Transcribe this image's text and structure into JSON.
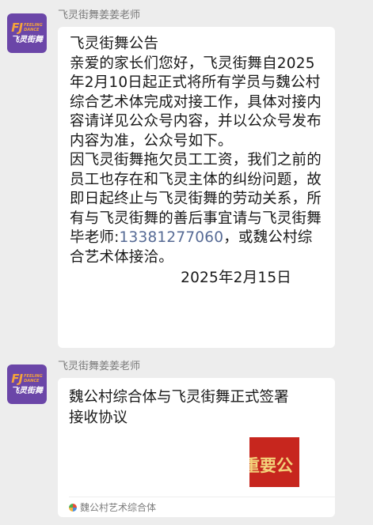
{
  "messages": [
    {
      "sender": "飞灵街舞姜姜老师",
      "avatar": {
        "logo_mark": "FJ",
        "logo_en": [
          "FEELING",
          "DANCE"
        ],
        "logo_cn": "飞灵街舞"
      },
      "text": {
        "title": "飞灵街舞公告",
        "para1": "亲爱的家长们您好，飞灵街舞自2025年2月10日起正式将所有学员与魏公村综合艺术体完成对接工作，具体对接内容请详见公众号内容，并以公众号发布内容为准，公众号如下。",
        "para2_before_phone": "因飞灵街舞拖欠员工工资，我们之前的员工也存在和飞灵主体的纠纷问题，故即日起终止与飞灵街舞的劳动关系，所有与飞灵街舞的善后事宜请与飞灵街舞毕老师:",
        "phone": "13381277060",
        "para2_after_phone": "，或魏公村综合艺术体接洽。",
        "date": "2025年2月15日"
      }
    },
    {
      "sender": "飞灵街舞姜姜老师",
      "avatar": {
        "logo_mark": "FJ",
        "logo_en": [
          "FEELING",
          "DANCE"
        ],
        "logo_cn": "飞灵街舞"
      },
      "card": {
        "title": "魏公村综合体与飞灵街舞正式签署接收协议",
        "thumbnail_text": "重要公",
        "source_icon": "mini-program-icon",
        "source": "魏公村艺术综合体"
      }
    }
  ],
  "colors": {
    "background": "#ededed",
    "bubble": "#ffffff",
    "avatar": "#6b46a8",
    "link": "#576b95",
    "thumbnail": "#c7261e"
  }
}
